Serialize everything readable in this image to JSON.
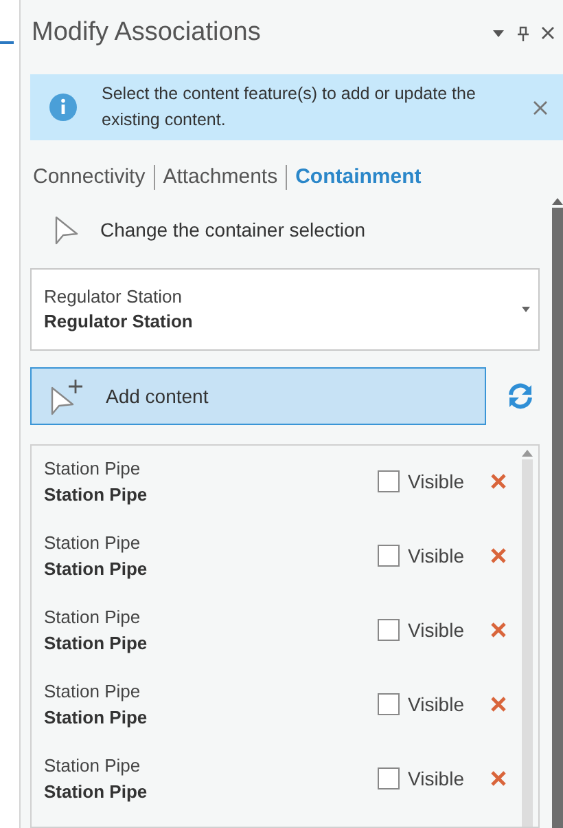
{
  "pane": {
    "title": "Modify Associations"
  },
  "info": {
    "message": "Select the content feature(s) to add or update the existing content."
  },
  "tabs": [
    {
      "label": "Connectivity",
      "selected": false
    },
    {
      "label": "Attachments",
      "selected": false
    },
    {
      "label": "Containment",
      "selected": true
    }
  ],
  "container_selection": {
    "label": "Change the container selection"
  },
  "container": {
    "layer": "Regulator Station",
    "name": "Regulator Station"
  },
  "add_content": {
    "label": "Add content"
  },
  "contents": [
    {
      "layer": "Station Pipe",
      "name": "Station Pipe",
      "visible_label": "Visible",
      "checked": false
    },
    {
      "layer": "Station Pipe",
      "name": "Station Pipe",
      "visible_label": "Visible",
      "checked": false
    },
    {
      "layer": "Station Pipe",
      "name": "Station Pipe",
      "visible_label": "Visible",
      "checked": false
    },
    {
      "layer": "Station Pipe",
      "name": "Station Pipe",
      "visible_label": "Visible",
      "checked": false
    },
    {
      "layer": "Station Pipe",
      "name": "Station Pipe",
      "visible_label": "Visible",
      "checked": false
    }
  ]
}
